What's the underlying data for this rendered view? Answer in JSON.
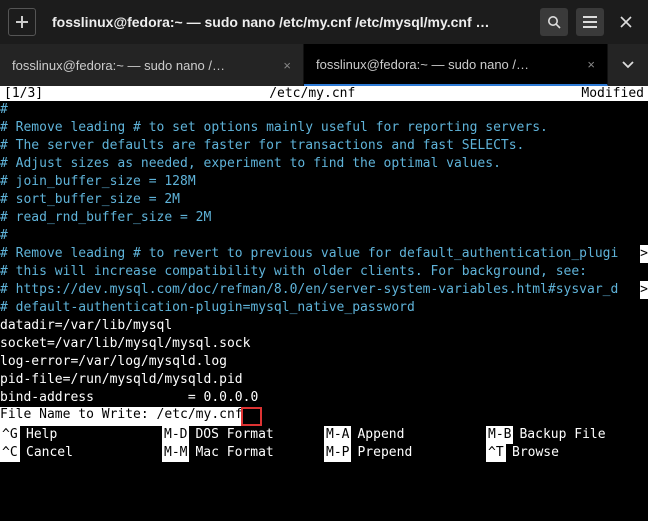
{
  "titlebar": {
    "title": "fosslinux@fedora:~ — sudo nano /etc/my.cnf /etc/mysql/my.cnf …"
  },
  "tabs": [
    {
      "label": "fosslinux@fedora:~ — sudo nano /…",
      "active": false
    },
    {
      "label": "fosslinux@fedora:~ — sudo nano /…",
      "active": true
    }
  ],
  "status": {
    "left": "[1/3]",
    "center": "/etc/my.cnf",
    "right": "Modified"
  },
  "lines": [
    {
      "t": "#",
      "c": true
    },
    {
      "t": "# Remove leading # to set options mainly useful for reporting servers.",
      "c": true
    },
    {
      "t": "# The server defaults are faster for transactions and fast SELECTs.",
      "c": true
    },
    {
      "t": "# Adjust sizes as needed, experiment to find the optimal values.",
      "c": true
    },
    {
      "t": "# join_buffer_size = 128M",
      "c": true
    },
    {
      "t": "# sort_buffer_size = 2M",
      "c": true
    },
    {
      "t": "# read_rnd_buffer_size = 2M",
      "c": true
    },
    {
      "t": "#",
      "c": true
    },
    {
      "t": "# Remove leading # to revert to previous value for default_authentication_plugi",
      "c": true,
      "arrow": true
    },
    {
      "t": "# this will increase compatibility with older clients. For background, see:",
      "c": true
    },
    {
      "t": "# https://dev.mysql.com/doc/refman/8.0/en/server-system-variables.html#sysvar_d",
      "c": true,
      "arrow": true
    },
    {
      "t": "# default-authentication-plugin=mysql_native_password",
      "c": true
    },
    {
      "t": "",
      "c": false
    },
    {
      "t": "datadir=/var/lib/mysql",
      "c": false
    },
    {
      "t": "socket=/var/lib/mysql/mysql.sock",
      "c": false
    },
    {
      "t": "",
      "c": false
    },
    {
      "t": "log-error=/var/log/mysqld.log",
      "c": false
    },
    {
      "t": "pid-file=/run/mysqld/mysqld.pid",
      "c": false
    },
    {
      "t": "bind-address            = 0.0.0.0",
      "c": false
    }
  ],
  "prompt": {
    "label": "File Name to Write: ",
    "value": "/etc/my.cnf"
  },
  "shortcuts_rows": [
    [
      {
        "key": "^G",
        "label": "Help"
      },
      {
        "key": "M-D",
        "label": "DOS Format"
      },
      {
        "key": "M-A",
        "label": "Append"
      },
      {
        "key": "M-B",
        "label": "Backup File"
      }
    ],
    [
      {
        "key": "^C",
        "label": "Cancel"
      },
      {
        "key": "M-M",
        "label": "Mac Format"
      },
      {
        "key": "M-P",
        "label": "Prepend"
      },
      {
        "key": "^T",
        "label": "Browse"
      }
    ]
  ]
}
